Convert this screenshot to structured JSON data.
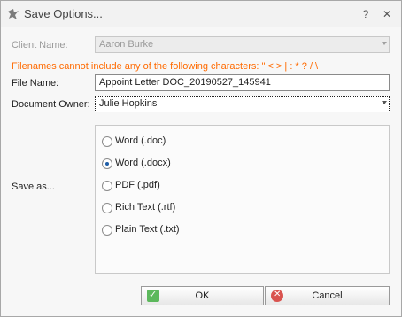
{
  "window": {
    "title": "Save Options...",
    "controls": {
      "help": "?",
      "close": "✕"
    }
  },
  "form": {
    "client_name_label": "Client Name:",
    "client_name_value": "Aaron Burke",
    "warning": "Filenames cannot include any of the following characters:  \" < > | : * ? / \\",
    "file_name_label": "File Name:",
    "file_name_value": "Appoint Letter DOC_20190527_145941",
    "document_owner_label": "Document Owner:",
    "document_owner_value": "Julie Hopkins",
    "save_as_label": "Save as...",
    "save_as_options": [
      {
        "label": "Word (.doc)",
        "checked": false
      },
      {
        "label": "Word (.docx)",
        "checked": true
      },
      {
        "label": "PDF (.pdf)",
        "checked": false
      },
      {
        "label": "Rich Text (.rtf)",
        "checked": false
      },
      {
        "label": "Plain Text (.txt)",
        "checked": false
      }
    ]
  },
  "buttons": {
    "ok": "OK",
    "cancel": "Cancel"
  }
}
